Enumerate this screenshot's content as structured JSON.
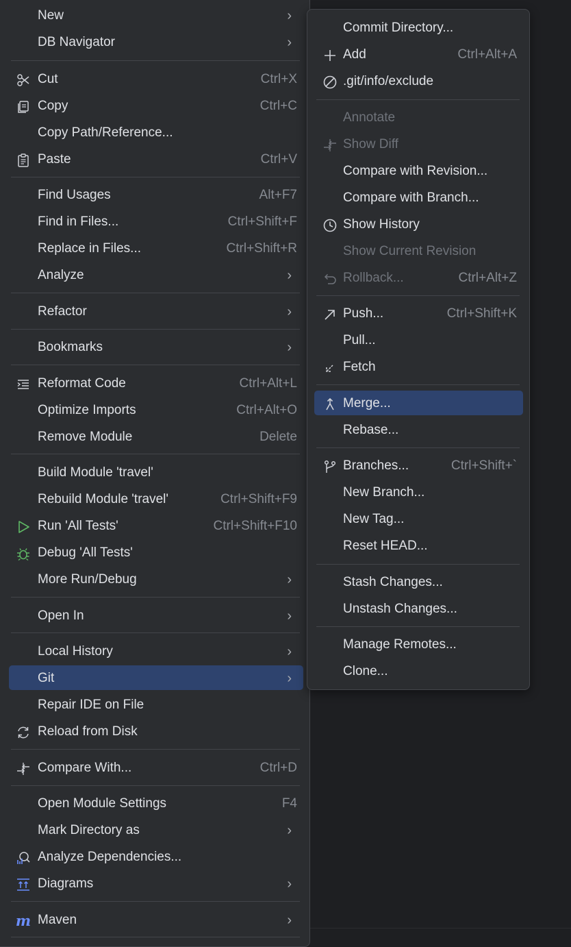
{
  "main_menu": {
    "items": [
      {
        "label": "New",
        "arrow": true,
        "icon": ""
      },
      {
        "label": "DB Navigator",
        "arrow": true,
        "icon": ""
      },
      {
        "label": "Cut",
        "shortcut": "Ctrl+X",
        "icon": "scissors-icon"
      },
      {
        "label": "Copy",
        "shortcut": "Ctrl+C",
        "icon": "copy-icon"
      },
      {
        "label": "Copy Path/Reference...",
        "icon": ""
      },
      {
        "label": "Paste",
        "shortcut": "Ctrl+V",
        "icon": "clipboard-icon"
      },
      {
        "label": "Find Usages",
        "shortcut": "Alt+F7"
      },
      {
        "label": "Find in Files...",
        "shortcut": "Ctrl+Shift+F"
      },
      {
        "label": "Replace in Files...",
        "shortcut": "Ctrl+Shift+R"
      },
      {
        "label": "Analyze",
        "arrow": true
      },
      {
        "label": "Refactor",
        "arrow": true
      },
      {
        "label": "Bookmarks",
        "arrow": true
      },
      {
        "label": "Reformat Code",
        "shortcut": "Ctrl+Alt+L",
        "icon": "reformat-icon"
      },
      {
        "label": "Optimize Imports",
        "shortcut": "Ctrl+Alt+O"
      },
      {
        "label": "Remove Module",
        "shortcut": "Delete"
      },
      {
        "label": "Build Module 'travel'"
      },
      {
        "label": "Rebuild Module 'travel'",
        "shortcut": "Ctrl+Shift+F9"
      },
      {
        "label": "Run 'All Tests'",
        "shortcut": "Ctrl+Shift+F10",
        "icon": "run-icon"
      },
      {
        "label": "Debug 'All Tests'",
        "icon": "debug-icon"
      },
      {
        "label": "More Run/Debug",
        "arrow": true
      },
      {
        "label": "Open In",
        "arrow": true
      },
      {
        "label": "Local History",
        "arrow": true
      },
      {
        "label": "Git",
        "arrow": true,
        "highlighted": true
      },
      {
        "label": "Repair IDE on File"
      },
      {
        "label": "Reload from Disk",
        "icon": "reload-icon"
      },
      {
        "label": "Compare With...",
        "shortcut": "Ctrl+D",
        "icon": "compare-icon"
      },
      {
        "label": "Open Module Settings",
        "shortcut": "F4"
      },
      {
        "label": "Mark Directory as",
        "arrow": true
      },
      {
        "label": "Analyze Dependencies...",
        "icon": "analyze-dependencies-icon"
      },
      {
        "label": "Diagrams",
        "arrow": true,
        "icon": "diagrams-icon"
      },
      {
        "label": "Maven",
        "arrow": true,
        "icon": "maven-icon"
      }
    ]
  },
  "git_menu": {
    "items": [
      {
        "label": "Commit Directory..."
      },
      {
        "label": "Add",
        "shortcut": "Ctrl+Alt+A",
        "icon": "plus-icon"
      },
      {
        "label": ".git/info/exclude",
        "icon": "ignore-icon"
      },
      {
        "label": "Annotate",
        "disabled": true
      },
      {
        "label": "Show Diff",
        "disabled": true,
        "icon": "diff-icon"
      },
      {
        "label": "Compare with Revision..."
      },
      {
        "label": "Compare with Branch..."
      },
      {
        "label": "Show History",
        "icon": "history-icon"
      },
      {
        "label": "Show Current Revision",
        "disabled": true
      },
      {
        "label": "Rollback...",
        "shortcut": "Ctrl+Alt+Z",
        "disabled": true,
        "icon": "rollback-icon"
      },
      {
        "label": "Push...",
        "shortcut": "Ctrl+Shift+K",
        "icon": "push-icon"
      },
      {
        "label": "Pull..."
      },
      {
        "label": "Fetch",
        "icon": "fetch-icon"
      },
      {
        "label": "Merge...",
        "highlighted": true,
        "icon": "merge-icon"
      },
      {
        "label": "Rebase..."
      },
      {
        "label": "Branches...",
        "shortcut": "Ctrl+Shift+`",
        "icon": "branch-icon"
      },
      {
        "label": "New Branch..."
      },
      {
        "label": "New Tag..."
      },
      {
        "label": "Reset HEAD..."
      },
      {
        "label": "Stash Changes..."
      },
      {
        "label": "Unstash Changes..."
      },
      {
        "label": "Manage Remotes..."
      },
      {
        "label": "Clone..."
      }
    ]
  },
  "colors": {
    "menu_bg": "#2b2d30",
    "highlight": "#2e436e",
    "text": "#dfe1e5",
    "shortcut": "#868a91",
    "disabled": "#6f737a",
    "run_green": "#5fb865",
    "maven_blue": "#6b8eff"
  }
}
